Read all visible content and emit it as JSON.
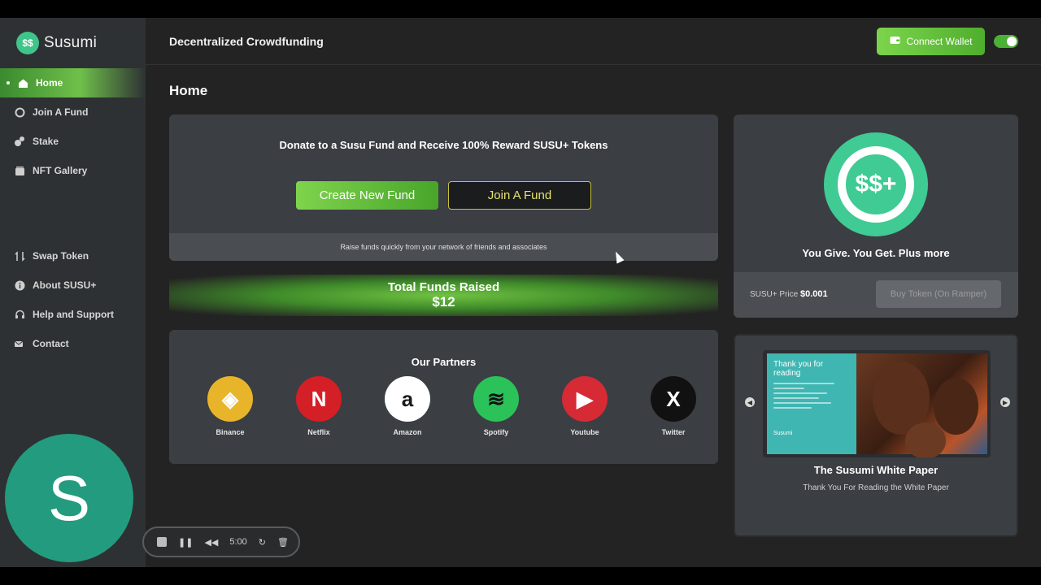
{
  "app": {
    "logo_text": "Susumi",
    "logo_mark": "$$"
  },
  "header": {
    "title": "Decentralized Crowdfunding",
    "connect_label": "Connect Wallet",
    "wallet_icon": "wallet-icon",
    "theme_toggle": "on"
  },
  "sidebar": {
    "primary": [
      {
        "label": "Home",
        "icon": "home-icon",
        "active": true
      },
      {
        "label": "Join A Fund",
        "icon": "fund-icon"
      },
      {
        "label": "Stake",
        "icon": "stake-icon"
      },
      {
        "label": "NFT Gallery",
        "icon": "gallery-icon"
      }
    ],
    "secondary": [
      {
        "label": "Swap Token",
        "icon": "swap-icon"
      },
      {
        "label": "About SUSU+",
        "icon": "info-icon"
      },
      {
        "label": "Help and Support",
        "icon": "headset-icon"
      },
      {
        "label": "Contact",
        "icon": "contact-icon"
      }
    ],
    "avatar_letter": "S",
    "avatar_color": "#239b7e"
  },
  "main": {
    "page_title": "Home",
    "donate": {
      "heading": "Donate to a Susu Fund and Receive 100% Reward SUSU+ Tokens",
      "create_label": "Create New Fund",
      "join_label": "Join A Fund",
      "footer_text": "Raise funds quickly from your network of friends and associates"
    },
    "funds": {
      "label": "Total Funds Raised",
      "value": "$12"
    },
    "partners": {
      "title": "Our Partners",
      "items": [
        {
          "name": "Binance",
          "glyph": "◈",
          "bg": "#e8b52a",
          "fg": "#ffffff"
        },
        {
          "name": "Netflix",
          "glyph": "N",
          "bg": "#d41f26",
          "fg": "#ffffff"
        },
        {
          "name": "Amazon",
          "glyph": "a",
          "bg": "#ffffff",
          "fg": "#1a1a1a"
        },
        {
          "name": "Spotify",
          "glyph": "≋",
          "bg": "#2bc25a",
          "fg": "#111111"
        },
        {
          "name": "Youtube",
          "glyph": "▶",
          "bg": "#d62a35",
          "fg": "#ffffff"
        },
        {
          "name": "Twitter",
          "glyph": "X",
          "bg": "#111111",
          "fg": "#ffffff"
        }
      ]
    }
  },
  "token": {
    "tagline": "You Give. You Get. Plus more",
    "logo_glyph": "$$+",
    "price_label": "SUSU+ Price",
    "price_value": "$0.001",
    "buy_label": "Buy Token (On Ramper)"
  },
  "paper": {
    "thumb_title": "Thank you for reading",
    "thumb_brand": "Susumi",
    "title": "The Susumi White Paper",
    "subtitle": "Thank You For Reading the White Paper"
  },
  "recorder": {
    "time": "5:00"
  },
  "colors": {
    "accent": "#6fc04a",
    "join_border": "#c7c43a",
    "card_bg": "#3b3e43",
    "sidebar_bg": "#2e3133"
  }
}
